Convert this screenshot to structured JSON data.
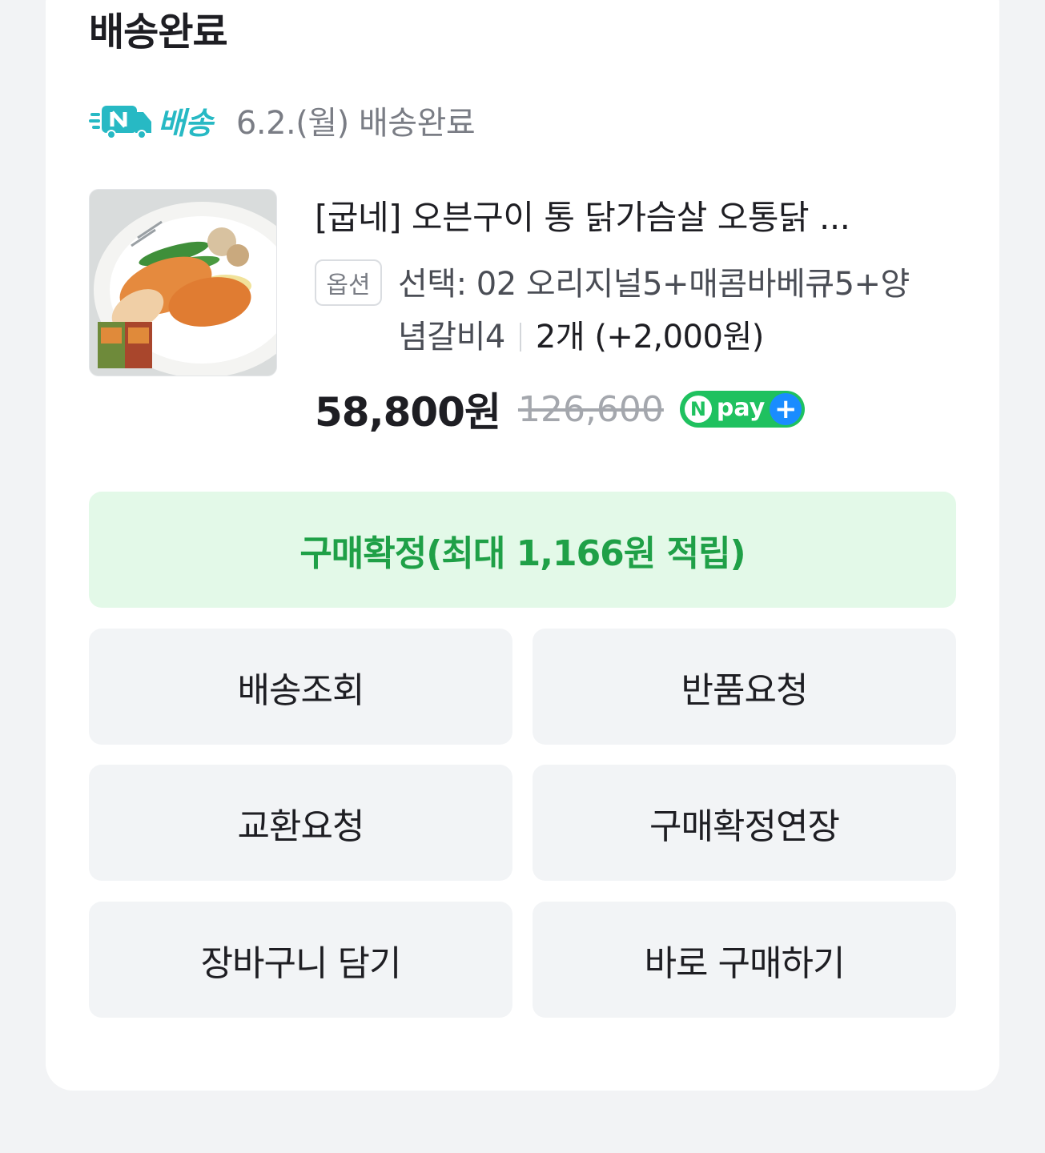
{
  "status": {
    "title": "배송완료"
  },
  "delivery": {
    "badge_label": "배송",
    "date_text": "6.2.(월) 배송완료"
  },
  "product": {
    "name": "[굽네] 오븐구이 통 닭가슴살 오통닭 ...",
    "option_chip": "옵션",
    "option_line1": "선택: 02 오리지널5+매콤바베큐5+양",
    "option_line2": "념갈비4",
    "quantity": "2개 (+2,000원)",
    "price": "58,800원",
    "original_price": "126,600",
    "npay_label": "pay"
  },
  "actions": {
    "confirm": "구매확정(최대 1,166원 적립)",
    "track": "배송조회",
    "return": "반품요청",
    "exchange": "교환요청",
    "extend": "구매확정연장",
    "cart": "장바구니 담기",
    "buy_now": "바로 구매하기"
  },
  "colors": {
    "confirm_bg": "#e3f9e8",
    "confirm_text": "#1fa047",
    "n_delivery": "#27b9c4",
    "npay_green": "#1fc15f",
    "npay_plus_blue": "#1a8cff"
  }
}
